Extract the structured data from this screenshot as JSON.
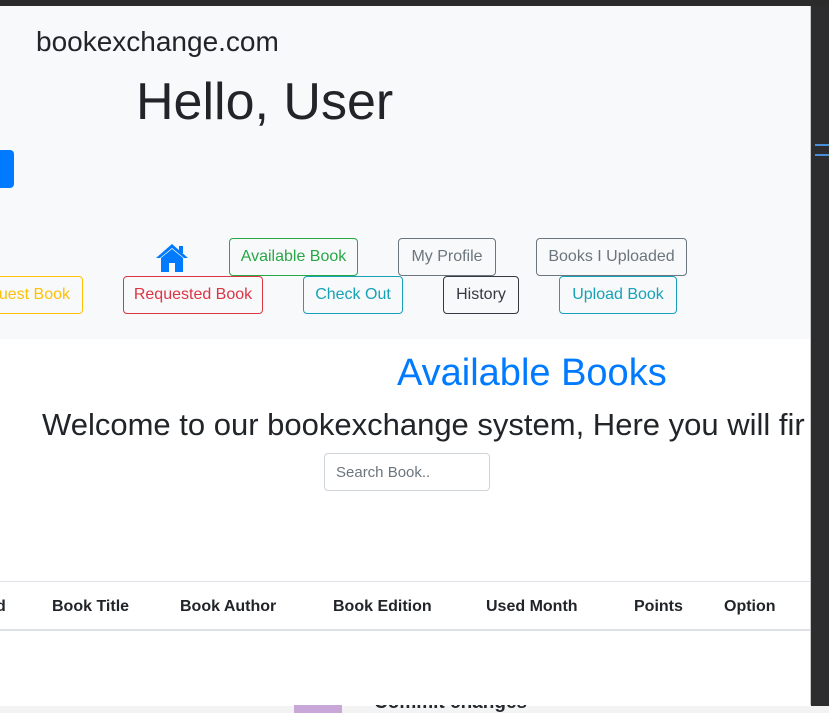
{
  "header": {
    "brand": "bookexchange.com",
    "greeting": "Hello, User"
  },
  "nav": {
    "available_book": "Available Book",
    "my_profile": "My Profile",
    "books_uploaded": "Books I Uploaded",
    "request_book_partial": "uest Book",
    "requested_book": "Requested Book",
    "check_out": "Check Out",
    "history": "History",
    "upload_book": "Upload Book"
  },
  "main": {
    "title": "Available Books",
    "welcome": "Welcome to our bookexchange system, Here you will fir",
    "search_placeholder": "Search Book.."
  },
  "table": {
    "columns": [
      "d",
      "Book Title",
      "Book Author",
      "Book Edition",
      "Used Month",
      "Points",
      "Option"
    ]
  },
  "background": {
    "text": "Commit changes"
  },
  "colors": {
    "primary": "#007bff",
    "success": "#28a745",
    "secondary": "#6c757d",
    "warning": "#ffc107",
    "danger": "#dc3545",
    "info": "#17a2b8",
    "dark": "#343a40",
    "jumbotron": "#f8f9fa"
  },
  "icons": {
    "home": "home-icon"
  }
}
